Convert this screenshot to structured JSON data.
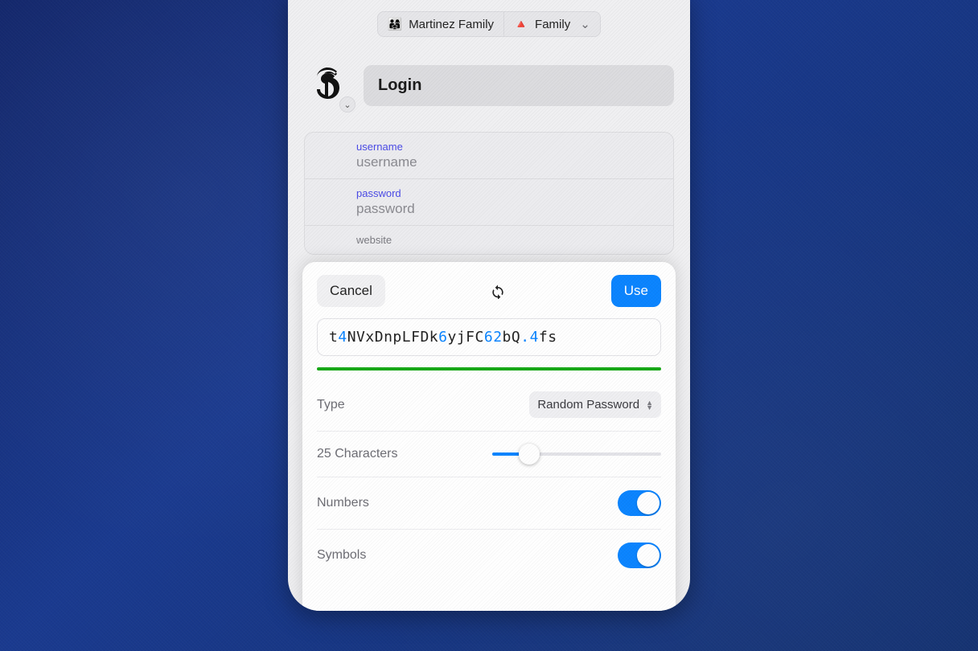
{
  "breadcrumbs": {
    "vault": {
      "icon": "👨‍👩‍👧",
      "label": "Martinez Family"
    },
    "category": {
      "icon": "🔺",
      "label": "Family"
    }
  },
  "item": {
    "title": "Login",
    "fields": {
      "username": {
        "label": "username",
        "value": "username"
      },
      "password": {
        "label": "password",
        "value": "password"
      },
      "website": {
        "label": "website",
        "value": ""
      }
    }
  },
  "generator": {
    "cancel_label": "Cancel",
    "use_label": "Use",
    "password_chars": [
      {
        "c": "t",
        "k": "l"
      },
      {
        "c": "4",
        "k": "d"
      },
      {
        "c": "N",
        "k": "l"
      },
      {
        "c": "V",
        "k": "l"
      },
      {
        "c": "x",
        "k": "l"
      },
      {
        "c": "D",
        "k": "l"
      },
      {
        "c": "n",
        "k": "l"
      },
      {
        "c": "p",
        "k": "l"
      },
      {
        "c": "L",
        "k": "l"
      },
      {
        "c": "F",
        "k": "l"
      },
      {
        "c": "D",
        "k": "l"
      },
      {
        "c": "k",
        "k": "l"
      },
      {
        "c": "6",
        "k": "d"
      },
      {
        "c": "y",
        "k": "l"
      },
      {
        "c": "j",
        "k": "l"
      },
      {
        "c": "F",
        "k": "l"
      },
      {
        "c": "C",
        "k": "l"
      },
      {
        "c": "6",
        "k": "d"
      },
      {
        "c": "2",
        "k": "d"
      },
      {
        "c": "b",
        "k": "l"
      },
      {
        "c": "Q",
        "k": "l"
      },
      {
        "c": ".",
        "k": "s"
      },
      {
        "c": "4",
        "k": "d"
      },
      {
        "c": "f",
        "k": "l"
      },
      {
        "c": "s",
        "k": "l"
      }
    ],
    "type_label": "Type",
    "type_value": "Random Password",
    "length_label": "25 Characters",
    "length_value": 25,
    "length_min": 8,
    "length_max": 64,
    "numbers_label": "Numbers",
    "numbers_on": true,
    "symbols_label": "Symbols",
    "symbols_on": true,
    "strength_color": "#16a816"
  }
}
